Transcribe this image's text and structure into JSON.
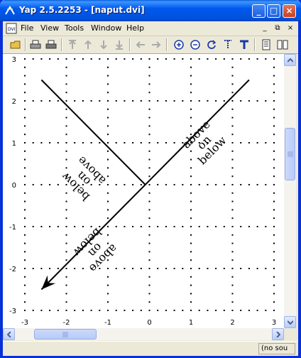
{
  "window": {
    "title": "Yap 2.5.2253 - [naput.dvi]",
    "buttons": {
      "minimize": "_",
      "maximize": "□",
      "close": "×"
    }
  },
  "menu": {
    "items": [
      "File",
      "View",
      "Tools",
      "Window",
      "Help"
    ],
    "mdi": {
      "minimize": "_",
      "restore": "⧉",
      "close": "×"
    }
  },
  "toolbar": {
    "icons": [
      "open-icon",
      "print-icon",
      "print-setup-icon",
      "first-page-icon",
      "prev-page-icon",
      "next-page-icon",
      "last-page-icon",
      "back-icon",
      "forward-icon",
      "zoom-in-icon",
      "zoom-out-icon",
      "refresh-icon",
      "source-special-icon",
      "text-icon",
      "single-page-icon",
      "double-page-icon"
    ]
  },
  "plot": {
    "x_ticks": [
      "-3",
      "-2",
      "-1",
      "0",
      "1",
      "2",
      "3"
    ],
    "y_ticks": [
      "3",
      "2",
      "1",
      "0",
      "-1",
      "-2",
      "-3"
    ],
    "labels": {
      "left_above": "above",
      "left_on": "on",
      "left_below": "below",
      "right_above": "above",
      "right_on": "on",
      "right_below": "below",
      "lower_above": "above",
      "lower_on": "on",
      "lower_below": "below"
    },
    "chart_data": {
      "type": "diagram",
      "grid": "dotted",
      "xlim": [
        -3,
        3
      ],
      "ylim": [
        -3,
        3
      ],
      "segments": [
        {
          "from": [
            -2.6,
            2.5
          ],
          "to": [
            -0.1,
            0.0
          ]
        },
        {
          "from": [
            2.4,
            2.5
          ],
          "to": [
            -2.6,
            -2.5
          ],
          "arrow": true
        }
      ]
    }
  },
  "status": {
    "source": "(no sou"
  },
  "colors": {
    "title_bar": "#0058ee",
    "window_border": "#0831d9",
    "close_button": "#c8421f"
  }
}
